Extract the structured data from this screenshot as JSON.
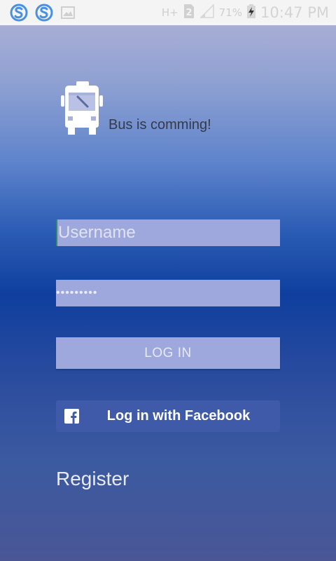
{
  "status_bar": {
    "network_label": "H+",
    "sim_label": "2",
    "battery_percent": "71%",
    "time": "10:47 PM"
  },
  "app": {
    "title": "Bus is comming!",
    "icon": "bus-icon"
  },
  "login_form": {
    "username_placeholder": "Username",
    "password_value": "•••••••••",
    "login_button_label": "LOG IN",
    "facebook_button_label": "Log in with Facebook",
    "register_link_label": "Register"
  },
  "colors": {
    "field_bg": "#9ea8dc",
    "facebook_bg": "#3e5aa8",
    "status_icon_blue": "#4a90e2"
  }
}
